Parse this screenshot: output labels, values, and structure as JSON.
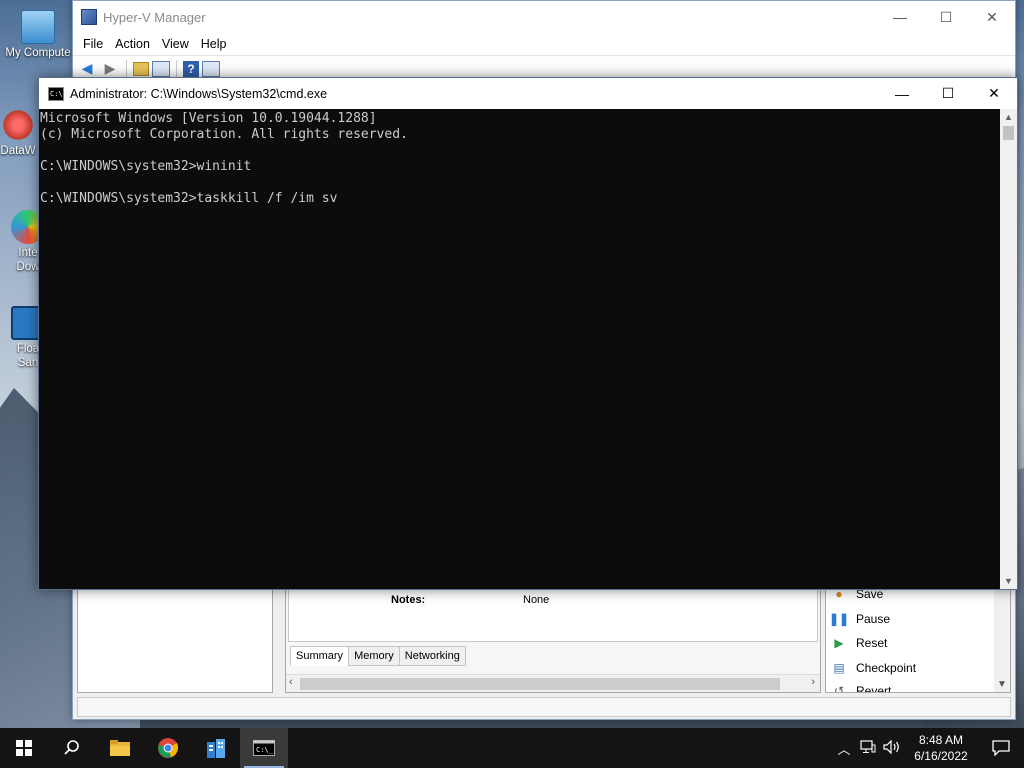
{
  "desktop": {
    "icons": [
      {
        "label": "My Compute"
      },
      {
        "label": "DataW"
      },
      {
        "label_line1": "Inte",
        "label_line2": "Dow"
      },
      {
        "label_line1": "Floa",
        "label_line2": "San"
      }
    ]
  },
  "hyperv": {
    "title": "Hyper-V Manager",
    "menu": [
      "File",
      "Action",
      "View",
      "Help"
    ],
    "notes_label": "Notes:",
    "notes_value": "None",
    "tabs": [
      "Summary",
      "Memory",
      "Networking"
    ],
    "actions": [
      "Save",
      "Pause",
      "Reset",
      "Checkpoint",
      "Revert"
    ]
  },
  "cmd": {
    "title": "Administrator: C:\\Windows\\System32\\cmd.exe",
    "lines": [
      "Microsoft Windows [Version 10.0.19044.1288]",
      "(c) Microsoft Corporation. All rights reserved.",
      "",
      "C:\\WINDOWS\\system32>wininit",
      "",
      "C:\\WINDOWS\\system32>taskkill /f /im sv"
    ]
  },
  "window_controls": {
    "minimize": "—",
    "maximize": "☐",
    "close": "✕"
  },
  "taskbar": {
    "time": "8:48 AM",
    "date": "6/16/2022"
  },
  "colors": {
    "console_bg": "#0c0c0c",
    "console_text": "#cccccc",
    "taskbar_bg": "#141414"
  }
}
